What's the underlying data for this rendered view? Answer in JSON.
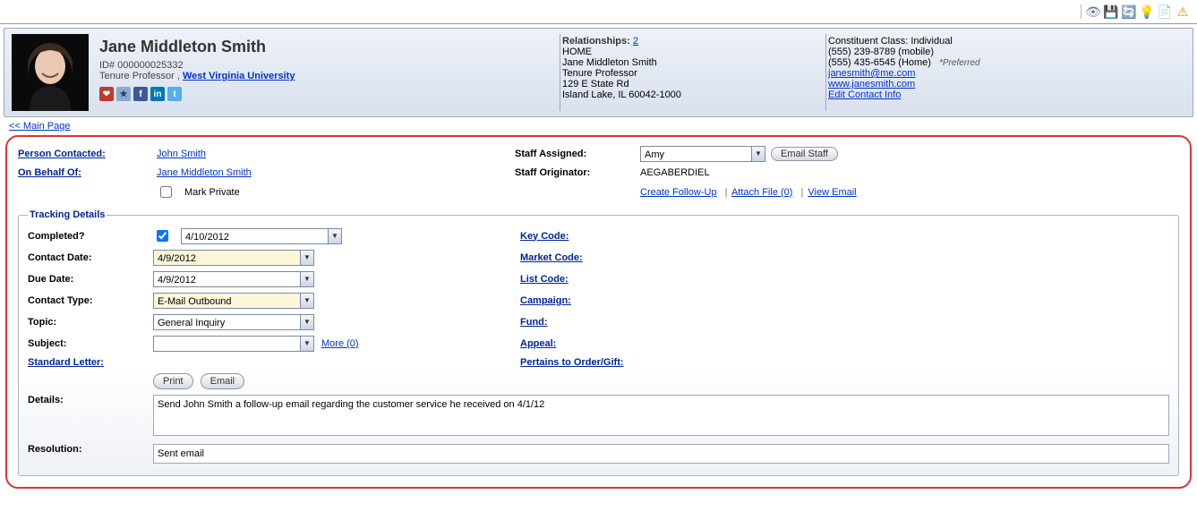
{
  "toolbar_icons": {
    "eye": "eye-icon",
    "save": "save-icon",
    "refresh": "refresh-icon",
    "bulb": "bulb-icon",
    "report": "report-icon",
    "warn": "warn-icon"
  },
  "header": {
    "name": "Jane Middleton Smith",
    "id_label": "ID# 000000025332",
    "role": "Tenure Professor , ",
    "org": "West Virginia University",
    "relationships_label": "Relationships:",
    "relationships_count": "2",
    "rel_lines": {
      "home": "HOME",
      "name": "Jane Middleton Smith",
      "title": "Tenure Professor",
      "addr1": "129 E State Rd",
      "addr2": "Island Lake, IL 60042-1000"
    },
    "class_line": "Constituent Class: Individual",
    "phone1": "(555) 239-8789 (mobile)",
    "phone2": "(555) 435-6545 (Home)",
    "preferred": "*Preferred",
    "email": "janesmith@me.com",
    "web": "www.janesmith.com",
    "edit_link": "Edit Contact Info"
  },
  "nav": {
    "main_page": "<< Main Page"
  },
  "top": {
    "person_contacted_label": "Person Contacted:",
    "person_contacted_value": "John Smith",
    "on_behalf_label": "On Behalf Of:",
    "on_behalf_value": "Jane Middleton Smith",
    "mark_private": "Mark Private",
    "staff_assigned_label": "Staff Assigned:",
    "staff_assigned_value": "Amy",
    "email_staff_btn": "Email Staff",
    "staff_originator_label": "Staff Originator:",
    "staff_originator_value": "AEGABERDIEL",
    "create_followup": "Create Follow-Up",
    "attach_file": "Attach File (0)",
    "view_email": "View Email"
  },
  "track": {
    "legend": "Tracking Details",
    "completed_label": "Completed?",
    "completed_date": "4/10/2012",
    "contact_date_label": "Contact Date:",
    "contact_date": "4/9/2012",
    "due_date_label": "Due Date:",
    "due_date": "4/9/2012",
    "contact_type_label": "Contact Type:",
    "contact_type": "E-Mail Outbound",
    "topic_label": "Topic:",
    "topic": "General Inquiry",
    "subject_label": "Subject:",
    "subject": "",
    "more_link": "More (0)",
    "standard_letter_label": "Standard Letter:",
    "print_btn": "Print",
    "email_btn": "Email",
    "details_label": "Details:",
    "details_text": "Send John Smith a follow-up email regarding the customer service he received on 4/1/12",
    "resolution_label": "Resolution:",
    "resolution_text": "Sent email",
    "right": {
      "key_code": "Key Code:",
      "market_code": "Market Code:",
      "list_code": "List Code:",
      "campaign": "Campaign:",
      "fund": "Fund:",
      "appeal": "Appeal:",
      "pertains": "Pertains to Order/Gift:"
    }
  }
}
